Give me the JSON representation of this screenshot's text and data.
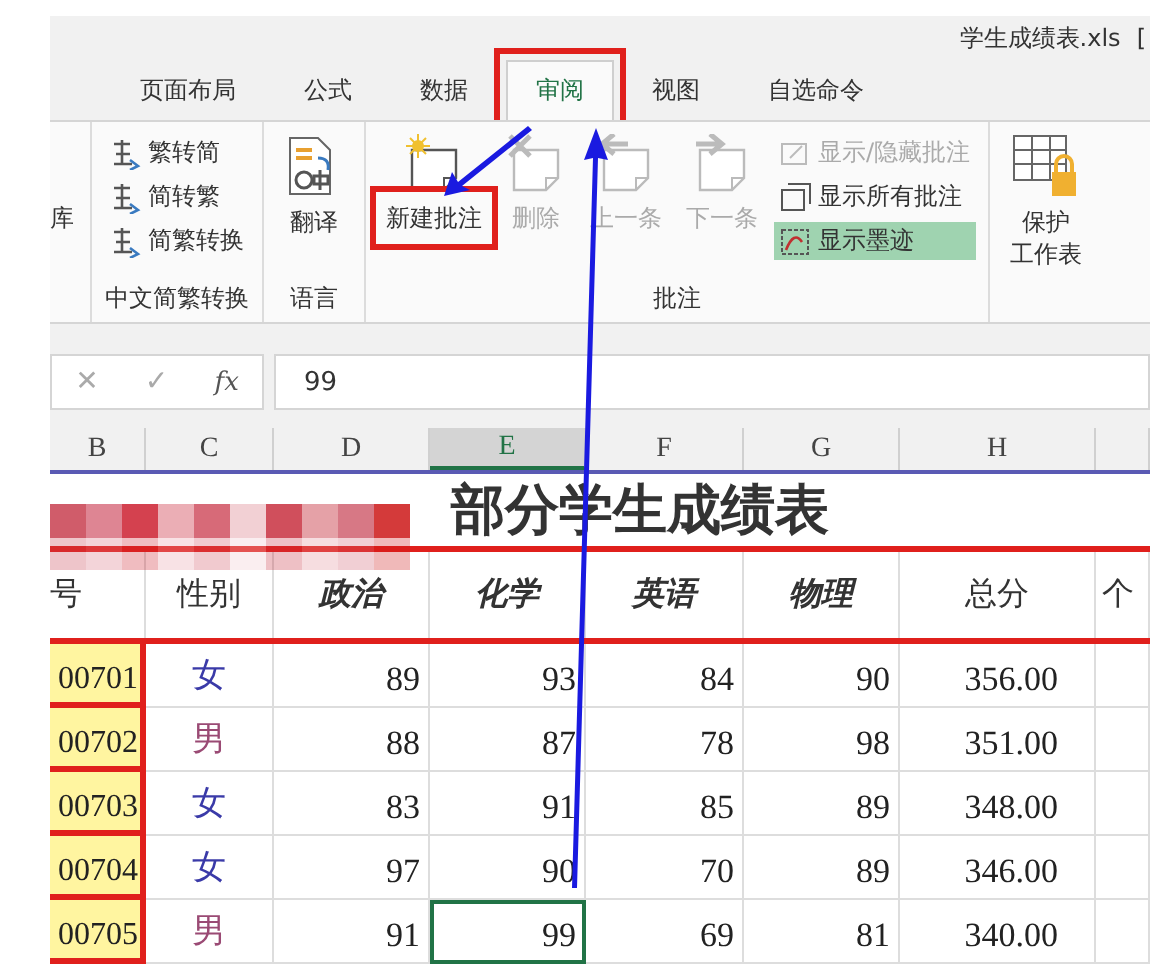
{
  "window": {
    "title": "学生成绩表.xls",
    "title_suffix": "["
  },
  "tabs": [
    {
      "label": "页面布局",
      "selected": false,
      "highlighted": false
    },
    {
      "label": "公式",
      "selected": false,
      "highlighted": false
    },
    {
      "label": "数据",
      "selected": false,
      "highlighted": false
    },
    {
      "label": "审阅",
      "selected": true,
      "highlighted": true
    },
    {
      "label": "视图",
      "selected": false,
      "highlighted": false
    },
    {
      "label": "自选命令",
      "selected": false,
      "highlighted": false
    }
  ],
  "ribbon": {
    "leading_label": "库",
    "groups": [
      {
        "kind": "list",
        "label": "中文简繁转换",
        "items": [
          {
            "label": "繁转简"
          },
          {
            "label": "简转繁"
          },
          {
            "label": "简繁转换"
          }
        ]
      },
      {
        "kind": "large",
        "label": "语言",
        "items": [
          {
            "lines": [
              "翻译"
            ],
            "disabled": false,
            "highlighted": false
          }
        ]
      },
      {
        "kind": "comments",
        "label": "批注",
        "items": [
          {
            "lines": [
              "新建批注"
            ],
            "disabled": false,
            "highlighted": true
          },
          {
            "lines": [
              "删除"
            ],
            "disabled": true,
            "highlighted": false
          },
          {
            "lines": [
              "上一条"
            ],
            "disabled": true,
            "highlighted": false
          },
          {
            "lines": [
              "下一条"
            ],
            "disabled": true,
            "highlighted": false
          }
        ],
        "options": [
          {
            "label": "显示/隐藏批注",
            "disabled": true,
            "on": false
          },
          {
            "label": "显示所有批注",
            "disabled": false,
            "on": false
          },
          {
            "label": "显示墨迹",
            "disabled": false,
            "on": true
          }
        ]
      },
      {
        "kind": "large",
        "items": [
          {
            "lines": [
              "保护",
              "工作表"
            ],
            "disabled": false,
            "highlighted": false
          }
        ]
      }
    ]
  },
  "formula_bar": {
    "cancel": "✕",
    "confirm": "✓",
    "function": "fx",
    "value": "99"
  },
  "sheet": {
    "columns": [
      {
        "label": "B",
        "selected": false
      },
      {
        "label": "C",
        "selected": false
      },
      {
        "label": "D",
        "selected": false
      },
      {
        "label": "E",
        "selected": true
      },
      {
        "label": "F",
        "selected": false
      },
      {
        "label": "G",
        "selected": false
      },
      {
        "label": "H",
        "selected": false
      },
      {
        "selected": false
      }
    ],
    "title": "部分学生成绩表",
    "headers": [
      "号",
      "性别",
      "政治",
      "化学",
      "英语",
      "物理",
      "总分",
      "个"
    ],
    "rows": [
      {
        "id": "00701",
        "gender": "女",
        "color": "#3a3aa8",
        "scores": [
          {
            "value": "89",
            "selected": false
          },
          {
            "value": "93",
            "selected": false
          },
          {
            "value": "84",
            "selected": false
          },
          {
            "value": "90",
            "selected": false
          }
        ],
        "total": "356.00"
      },
      {
        "id": "00702",
        "gender": "男",
        "color": "#9a4a74",
        "scores": [
          {
            "value": "88",
            "selected": false
          },
          {
            "value": "87",
            "selected": false
          },
          {
            "value": "78",
            "selected": false
          },
          {
            "value": "98",
            "selected": false
          }
        ],
        "total": "351.00"
      },
      {
        "id": "00703",
        "gender": "女",
        "color": "#3a3aa8",
        "scores": [
          {
            "value": "83",
            "selected": false
          },
          {
            "value": "91",
            "selected": false
          },
          {
            "value": "85",
            "selected": false
          },
          {
            "value": "89",
            "selected": false
          }
        ],
        "total": "348.00"
      },
      {
        "id": "00704",
        "gender": "女",
        "color": "#3a3aa8",
        "scores": [
          {
            "value": "97",
            "selected": false
          },
          {
            "value": "90",
            "selected": false
          },
          {
            "value": "70",
            "selected": false
          },
          {
            "value": "89",
            "selected": false
          }
        ],
        "total": "346.00"
      },
      {
        "id": "00705",
        "gender": "男",
        "color": "#9a4a74",
        "scores": [
          {
            "value": "91",
            "selected": false
          },
          {
            "value": "99",
            "selected": true
          },
          {
            "value": "69",
            "selected": false
          },
          {
            "value": "81",
            "selected": false
          }
        ],
        "total": "340.00"
      }
    ]
  }
}
